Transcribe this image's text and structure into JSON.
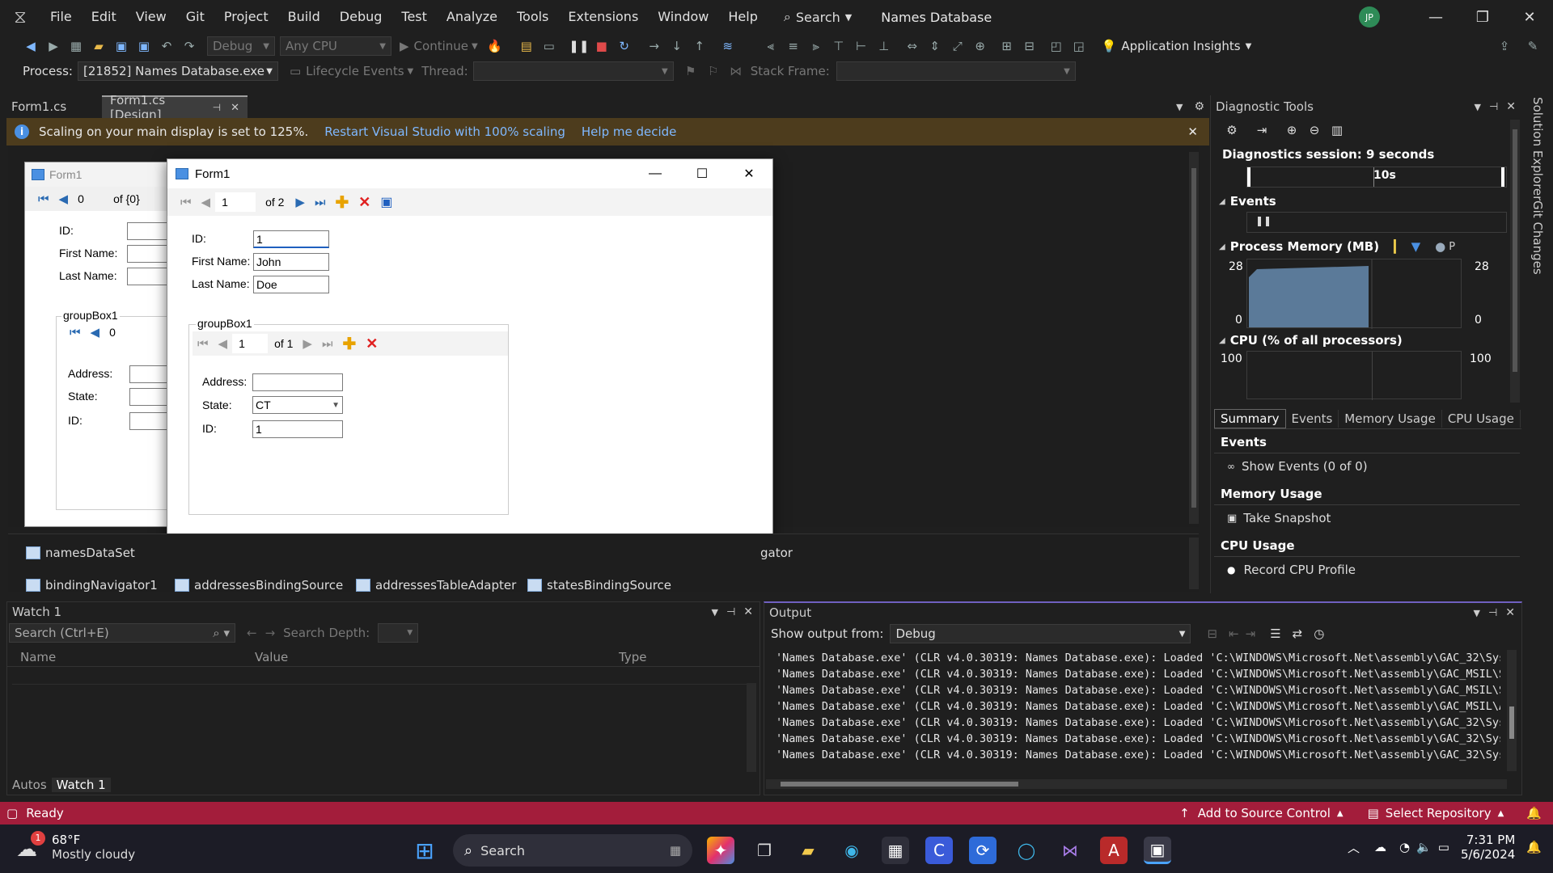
{
  "title_bar": {
    "menu": [
      "File",
      "Edit",
      "View",
      "Git",
      "Project",
      "Build",
      "Debug",
      "Test",
      "Analyze",
      "Tools",
      "Extensions",
      "Window",
      "Help"
    ],
    "search_label": "Search",
    "solution_name": "Names Database",
    "avatar_initials": "JP"
  },
  "toolbar": {
    "config": "Debug",
    "platform": "Any CPU",
    "continue_label": "Continue",
    "app_insights": "Application Insights",
    "process_label": "Process:",
    "process_value": "[21852] Names Database.exe",
    "lifecycle_label": "Lifecycle Events",
    "thread_label": "Thread:",
    "stack_frame_label": "Stack Frame:"
  },
  "doc_tabs": [
    {
      "label": "Form1.cs"
    },
    {
      "label": "Form1.cs [Design]"
    }
  ],
  "infobar": {
    "message": "Scaling on your main display is set to 125%.",
    "link1": "Restart Visual Studio with 100% scaling",
    "link2": "Help me decide"
  },
  "designer_form": {
    "title": "Form1",
    "position": "0",
    "count": "of {0}",
    "labels": {
      "id": "ID:",
      "first": "First Name:",
      "last": "Last Name:"
    },
    "group_title": "groupBox1",
    "group_position": "0",
    "group_labels": {
      "address": "Address:",
      "state": "State:",
      "id": "ID:"
    }
  },
  "running_form": {
    "title": "Form1",
    "position": "1",
    "count": "of 2",
    "labels": {
      "id": "ID:",
      "first": "First Name:",
      "last": "Last Name:"
    },
    "values": {
      "id": "1",
      "first": "John",
      "last": "Doe"
    },
    "group_title": "groupBox1",
    "group_position": "1",
    "group_count": "of 1",
    "group_labels": {
      "address": "Address:",
      "state": "State:",
      "id": "ID:"
    },
    "group_values": {
      "address": "",
      "state": "CT",
      "id": "1"
    }
  },
  "tray": {
    "row1": [
      "namesDataSet",
      "gator"
    ],
    "row2": [
      "bindingNavigator1",
      "addressesBindingSource",
      "addressesTableAdapter",
      "statesBindingSource"
    ]
  },
  "diagnostics": {
    "title": "Diagnostic Tools",
    "session": "Diagnostics session: 9 seconds",
    "timeline_label": "10s",
    "events_header": "Events",
    "memory_header": "Process Memory (MB)",
    "memory_legend": "P",
    "memory_max_left": "28",
    "memory_min_left": "0",
    "memory_max_right": "28",
    "memory_min_right": "0",
    "cpu_header": "CPU (% of all processors)",
    "cpu_max_left": "100",
    "cpu_max_right": "100",
    "tabs": [
      "Summary",
      "Events",
      "Memory Usage",
      "CPU Usage"
    ],
    "sec_events": "Events",
    "show_events": "Show Events (0 of 0)",
    "sec_memory": "Memory Usage",
    "take_snapshot": "Take Snapshot",
    "sec_cpu": "CPU Usage",
    "record_cpu": "Record CPU Profile"
  },
  "side_rail": [
    "Solution Explorer",
    "Git Changes"
  ],
  "watch": {
    "title": "Watch 1",
    "search_placeholder": "Search (Ctrl+E)",
    "search_depth": "Search Depth:",
    "columns": [
      "Name",
      "Value",
      "Type"
    ],
    "bottom_tabs": [
      "Autos",
      "Watch 1"
    ]
  },
  "output": {
    "title": "Output",
    "show_from_label": "Show output from:",
    "source": "Debug",
    "lines": [
      "'Names Database.exe' (CLR v4.0.30319: Names Database.exe): Loaded 'C:\\WINDOWS\\Microsoft.Net\\assembly\\GAC_32\\Syst",
      "'Names Database.exe' (CLR v4.0.30319: Names Database.exe): Loaded 'C:\\WINDOWS\\Microsoft.Net\\assembly\\GAC_MSIL\\Sy",
      "'Names Database.exe' (CLR v4.0.30319: Names Database.exe): Loaded 'C:\\WINDOWS\\Microsoft.Net\\assembly\\GAC_MSIL\\Sy",
      "'Names Database.exe' (CLR v4.0.30319: Names Database.exe): Loaded 'C:\\WINDOWS\\Microsoft.Net\\assembly\\GAC_MSIL\\Ac",
      "'Names Database.exe' (CLR v4.0.30319: Names Database.exe): Loaded 'C:\\WINDOWS\\Microsoft.Net\\assembly\\GAC_32\\Syst",
      "'Names Database.exe' (CLR v4.0.30319: Names Database.exe): Loaded 'C:\\WINDOWS\\Microsoft.Net\\assembly\\GAC_32\\Syst",
      "'Names Database.exe' (CLR v4.0.30319: Names Database.exe): Loaded 'C:\\WINDOWS\\Microsoft.Net\\assembly\\GAC_32\\Syst"
    ]
  },
  "status_bar": {
    "state": "Ready",
    "add_source_control": "Add to Source Control",
    "select_repo": "Select Repository"
  },
  "taskbar": {
    "temperature": "68°F",
    "weather": "Mostly cloudy",
    "weather_badge": "1",
    "search_label": "Search",
    "time": "7:31 PM",
    "date": "5/6/2024"
  },
  "colors": {
    "accent": "#7fb8ff",
    "status_bar": "#a31d3b",
    "infobar": "#4d3c1d",
    "memory_fill": "#5b7a99"
  }
}
